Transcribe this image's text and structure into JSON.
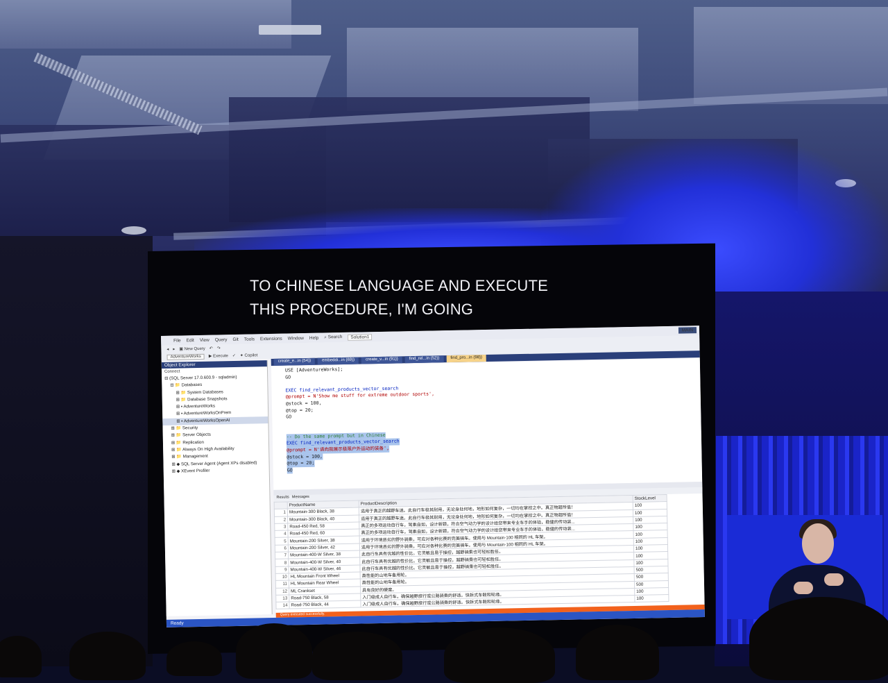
{
  "caption": {
    "line1": "TO CHINESE LANGUAGE AND EXECUTE",
    "line2": "THIS PROCEDURE, I'M GOING"
  },
  "ssms": {
    "menu": [
      "File",
      "Edit",
      "View",
      "Query",
      "Git",
      "Tools",
      "Extensions",
      "Window",
      "Help"
    ],
    "search_label": "Search",
    "solution_label": "Solution1",
    "main_badge": "MAIN",
    "toolbar": {
      "new_query": "New Query",
      "database": "AdventureWorks",
      "execute": "Execute",
      "copilot": "Copilot"
    },
    "tabs": [
      "create_e...in (54))",
      "embeddi...in (69))",
      "create_v...in (91))",
      "find_rel...in (52))",
      "find_pro...in (98))"
    ],
    "object_explorer": {
      "title": "Object Explorer",
      "connect": "Connect",
      "server": "(SQL Server 17.0.600.9 - sqladmin)",
      "items": [
        "Databases",
        "System Databases",
        "Database Snapshots",
        "AdventureWorks",
        "AdventureWorksOnPrem",
        "AdventureWorksOpenAI",
        "Security",
        "Server Objects",
        "Replication",
        "Always On High Availability",
        "Management",
        "SQL Server Agent (Agent XPs disabled)",
        "XEvent Profiler"
      ]
    },
    "code": {
      "l1": "USE [AdventureWorks];",
      "l2": "GO",
      "l3": "EXEC find_relevant_products_vector_search",
      "l4": "@prompt = N'Show me stuff for extreme outdoor sports',",
      "l5": "@stock = 100,",
      "l6": "@top = 20;",
      "l7": "GO",
      "l8": "-- Do the same prompt but in Chinese",
      "l9": "EXEC find_relevant_products_vector_search",
      "l10": "@prompt = N'请向我展示极限户外运动的装备',",
      "l11": "@stock = 100,",
      "l12": "@top = 20;",
      "l13": "GO"
    },
    "results_tabs": [
      "Results",
      "Messages"
    ],
    "results": {
      "headers": [
        "ProductName",
        "ProductDescription",
        "StockLevel"
      ],
      "rows": [
        [
          "1",
          "Mountain-300 Black, 38",
          "适用于真正的越野车迷。此自行车极其耐用，无论身处何地，地形如何复杂，一切均在掌控之中。真正物超所值！",
          "100"
        ],
        [
          "2",
          "Mountain-300 Black, 40",
          "适用于真正的越野车迷。此自行车极其耐用，无论身处何地，地形如何复杂，一切均在掌控之中。真正物超所值！",
          "100"
        ],
        [
          "3",
          "Road-450 Red, 58",
          "真正的多项运动自行车，驾乘自如，设计新颖，符合空气动力学的设计给您带来专业车手的体验，稳健的传动装...",
          "100"
        ],
        [
          "4",
          "Road-450 Red, 60",
          "真正的多项运动自行车，驾乘自如，设计新颖，符合空气动力学的设计给您带来专业车手的体验，稳健的传动装...",
          "100"
        ],
        [
          "5",
          "Mountain-200 Silver, 38",
          "适用于环境恶劣的野外骑乘，可应对各种比赛的完美骑车。使用与 Mountain-100 相同的 HL 车架。",
          "100"
        ],
        [
          "6",
          "Mountain-200 Silver, 42",
          "适用于环境恶劣的野外骑乘，可应对各种比赛的完美骑车。使用与 Mountain-100 相同的 HL 车架。",
          "100"
        ],
        [
          "7",
          "Mountain-400-W Silver, 38",
          "此自行车具有优越的性价比。它灵敏且易于操控，越野骑乘也可轻松胜任。",
          "100"
        ],
        [
          "8",
          "Mountain-400-W Silver, 40",
          "此自行车具有优越的性价比。它灵敏且易于操控，越野骑乘也可轻松胜任。",
          "100"
        ],
        [
          "9",
          "Mountain-400-W Silver, 46",
          "此自行车具有优越的性价比。它灵敏且易于操控，越野骑乘也可轻松胜任。",
          "100"
        ],
        [
          "10",
          "HL Mountain Front Wheel",
          "高性能的山地车备用轮。",
          "500"
        ],
        [
          "11",
          "HL Mountain Rear Wheel",
          "高性能的山地车备用轮。",
          "500"
        ],
        [
          "12",
          "ML Crankset",
          "具有良好的硬度。",
          "500"
        ],
        [
          "13",
          "Road-750 Black, 58",
          "入门级成人自行车，确保越野旅行或公路骑乘的舒适。快拆式车毂和轮缘。",
          "100"
        ],
        [
          "14",
          "Road-750 Black, 44",
          "入门级成人自行车，确保越野旅行或公路骑乘的舒适。快拆式车毂和轮缘。",
          "100"
        ]
      ]
    },
    "query_status": "Query executed successfully.",
    "ready": "Ready"
  },
  "colors": {
    "ssms_accent": "#2a3f7a",
    "status_orange": "#f2611c",
    "ready_blue": "#2b55c4",
    "stage_blue": "#2230d8"
  }
}
